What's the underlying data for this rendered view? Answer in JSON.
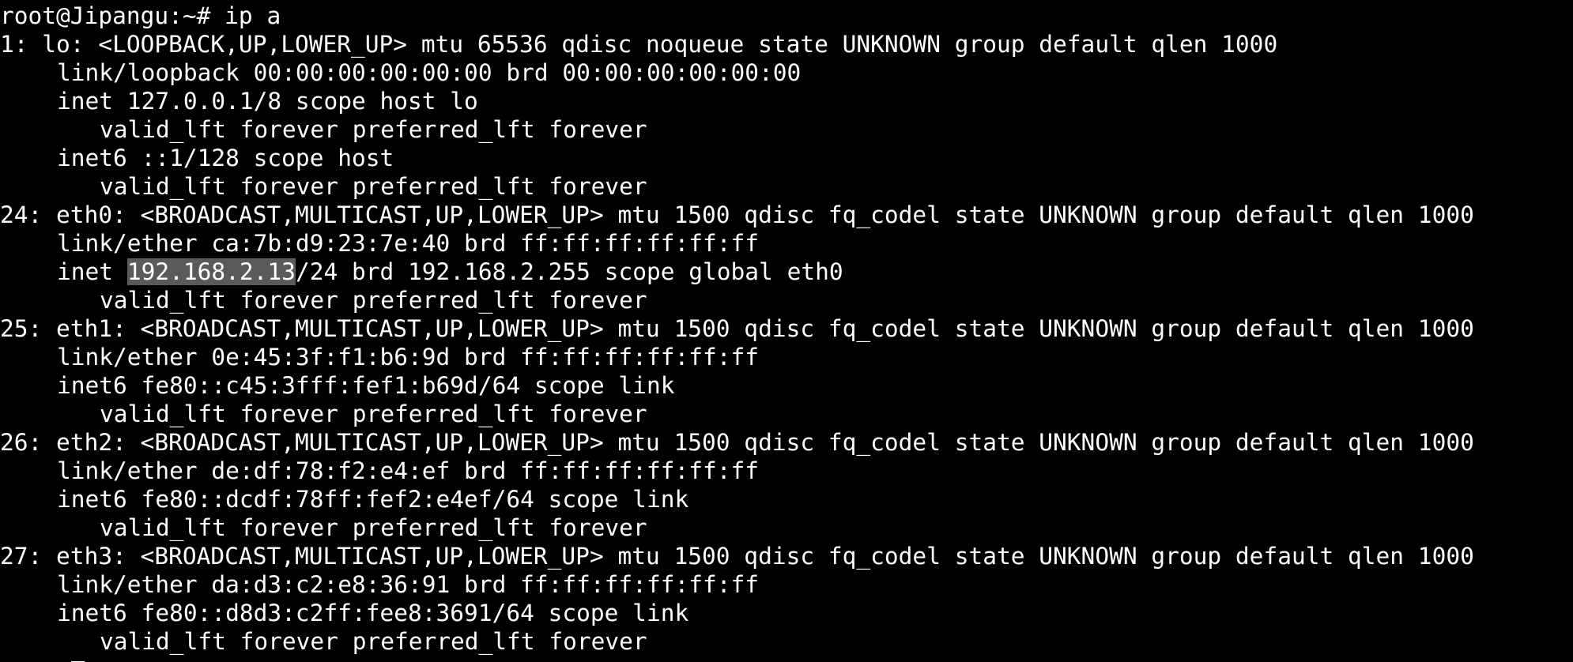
{
  "terminal": {
    "background": "#000000",
    "foreground": "#ffffff",
    "prompt_line": "root@Jipangu:~# ip a",
    "interfaces": {
      "lo": {
        "header": "1: lo: <LOOPBACK,UP,LOWER_UP> mtu 65536 qdisc noqueue state UNKNOWN group default qlen 1000",
        "link": "link/loopback 00:00:00:00:00:00 brd 00:00:00:00:00:00",
        "inet": "inet 127.0.0.1/8 scope host lo",
        "inet_lft": "valid_lft forever preferred_lft forever",
        "inet6": "inet6 ::1/128 scope host",
        "inet6_lft": "valid_lft forever preferred_lft forever"
      },
      "eth0": {
        "header": "24: eth0: <BROADCAST,MULTICAST,UP,LOWER_UP> mtu 1500 qdisc fq_codel state UNKNOWN group default qlen 1000",
        "link": "link/ether ca:7b:d9:23:7e:40 brd ff:ff:ff:ff:ff:ff",
        "inet_prefix": "inet ",
        "inet_selected": "192.168.2.13",
        "inet_rest": "/24 brd 192.168.2.255 scope global eth0",
        "inet_lft": "valid_lft forever preferred_lft forever"
      },
      "eth1": {
        "header": "25: eth1: <BROADCAST,MULTICAST,UP,LOWER_UP> mtu 1500 qdisc fq_codel state UNKNOWN group default qlen 1000",
        "link": "link/ether 0e:45:3f:f1:b6:9d brd ff:ff:ff:ff:ff:ff",
        "inet6": "inet6 fe80::c45:3fff:fef1:b69d/64 scope link",
        "inet6_lft": "valid_lft forever preferred_lft forever"
      },
      "eth2": {
        "header": "26: eth2: <BROADCAST,MULTICAST,UP,LOWER_UP> mtu 1500 qdisc fq_codel state UNKNOWN group default qlen 1000",
        "link": "link/ether de:df:78:f2:e4:ef brd ff:ff:ff:ff:ff:ff",
        "inet6": "inet6 fe80::dcdf:78ff:fef2:e4ef/64 scope link",
        "inet6_lft": "valid_lft forever preferred_lft forever"
      },
      "eth3": {
        "header": "27: eth3: <BROADCAST,MULTICAST,UP,LOWER_UP> mtu 1500 qdisc fq_codel state UNKNOWN group default qlen 1000",
        "link": "link/ether da:d3:c2:e8:36:91 brd ff:ff:ff:ff:ff:ff",
        "inet6": "inet6 fe80::d8d3:c2ff:fee8:3691/64 scope link",
        "inet6_lft": "valid_lft forever preferred_lft forever"
      }
    },
    "selection_color": "#5a5a5a"
  }
}
